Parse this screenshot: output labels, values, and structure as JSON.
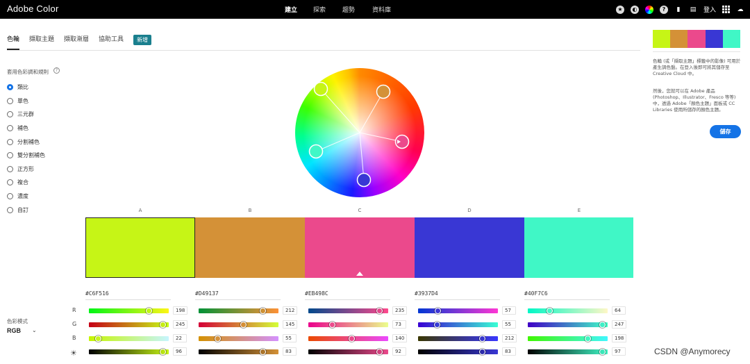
{
  "app": {
    "title": "Adobe Color"
  },
  "nav": {
    "items": [
      "建立",
      "探索",
      "趨勢",
      "資料庫"
    ],
    "active": 0
  },
  "topbar": {
    "login_label": "登入"
  },
  "tabs": {
    "items": [
      "色輪",
      "擷取主題",
      "擷取漸層",
      "協助工具"
    ],
    "active": 0,
    "new_badge": "新增"
  },
  "harmony": {
    "title": "套用色彩調和規則",
    "help": "?",
    "rules": [
      "類比",
      "單色",
      "三元群",
      "補色",
      "分割補色",
      "雙分割補色",
      "正方形",
      "複合",
      "濃度",
      "自訂"
    ],
    "selected": 0
  },
  "color_mode": {
    "label": "色彩模式",
    "value": "RGB"
  },
  "colors": [
    {
      "letter": "A",
      "hex": "#C6F516",
      "rgb": [
        198,
        245,
        22
      ],
      "brightness": 96
    },
    {
      "letter": "B",
      "hex": "#D49137",
      "rgb": [
        212,
        145,
        55
      ],
      "brightness": 83
    },
    {
      "letter": "C",
      "hex": "#EB498C",
      "rgb": [
        235,
        73,
        140
      ],
      "brightness": 92
    },
    {
      "letter": "D",
      "hex": "#3937D4",
      "rgb": [
        57,
        55,
        212
      ],
      "brightness": 83
    },
    {
      "letter": "E",
      "hex": "#40F7C6",
      "rgb": [
        64,
        247,
        198
      ],
      "brightness": 97
    }
  ],
  "selected_color": 0,
  "channels": {
    "r": "R",
    "g": "G",
    "b": "B"
  },
  "right_panel": {
    "para1": "色輪 (或「擷取主題」標籤中的影像) 可用於產生調色盤。在登入後即可將其儲存至 Creative Cloud 中。",
    "para2": "然後，您就可以在 Adobe 產品 (Photoshop、Illustrator、Fresco 等等) 中，透過 Adobe「顏色主題」面板或 CC Libraries 使用所儲存的顏色主題。",
    "save_label": "儲存"
  },
  "watermark": "CSDN @Anymorecy",
  "icons": [
    "star-icon",
    "moon-icon",
    "color-wheel-icon",
    "help-icon",
    "alert-icon",
    "chat-icon",
    "apps-grid-icon",
    "creative-cloud-icon"
  ]
}
